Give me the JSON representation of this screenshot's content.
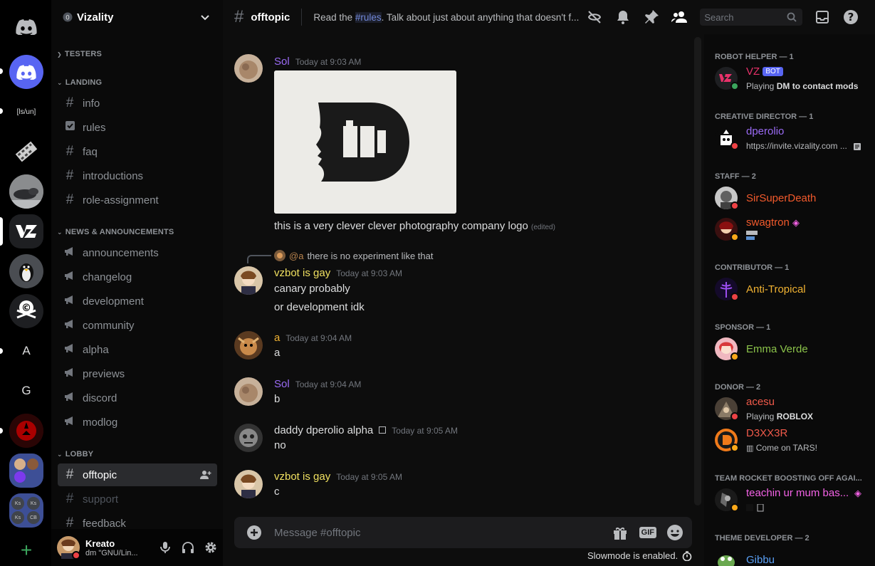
{
  "guild": {
    "name": "Vizality"
  },
  "rail": {
    "text_server_1": "[ls/un]",
    "letter_a": "A",
    "letter_g": "G",
    "folder_labels": [
      "Ks",
      "Ks",
      "Ks",
      "CB"
    ]
  },
  "categories": {
    "testers": "TESTERS",
    "landing": "LANDING",
    "news": "NEWS & ANNOUNCEMENTS",
    "lobby": "LOBBY"
  },
  "channels": {
    "landing": [
      "info",
      "rules",
      "faq",
      "introductions",
      "role-assignment"
    ],
    "news": [
      "announcements",
      "changelog",
      "development",
      "community",
      "alpha",
      "previews",
      "discord",
      "modlog"
    ],
    "lobby": [
      "offtopic",
      "support",
      "feedback"
    ]
  },
  "user": {
    "name": "Kreato",
    "status": "dm \"GNU/Lin..."
  },
  "header": {
    "channel": "offtopic",
    "topic_prefix": "Read the ",
    "topic_mention": "#rules",
    "topic_suffix": ". Talk about just about anything that doesn't f...",
    "search_placeholder": "Search"
  },
  "messages": [
    {
      "author": "Sol",
      "time": "Today at 9:03 AM",
      "text": "this is a very clever clever photography company logo",
      "edited": "(edited)"
    },
    {
      "reply_author": "@a",
      "reply_text": "there is no experiment like that",
      "author": "vzbot is gay",
      "time": "Today at 9:03 AM",
      "lines": [
        "canary probably",
        "or development idk"
      ]
    },
    {
      "author": "a",
      "time": "Today at 9:04 AM",
      "text": "a"
    },
    {
      "author": "Sol",
      "time": "Today at 9:04 AM",
      "text": "b"
    },
    {
      "author": "daddy dperolio alpha",
      "time": "Today at 9:05 AM",
      "text": "no"
    },
    {
      "author": "vzbot is gay",
      "time": "Today at 9:05 AM",
      "text": "c"
    }
  ],
  "composer": {
    "placeholder": "Message #offtopic",
    "gif": "GIF",
    "slowmode": "Slowmode is enabled."
  },
  "members": {
    "groups": [
      {
        "title": "ROBOT HELPER — 1"
      },
      {
        "title": "CREATIVE DIRECTOR — 1"
      },
      {
        "title": "STAFF — 2"
      },
      {
        "title": "CONTRIBUTOR — 1"
      },
      {
        "title": "SPONSOR — 1"
      },
      {
        "title": "DONOR — 2"
      },
      {
        "title": "TEAM ROCKET BOOSTING OFF AGAI..."
      },
      {
        "title": "THEME DEVELOPER — 2"
      }
    ],
    "list": [
      {
        "name": "VZ",
        "badge": "BOT",
        "act_pre": "Playing ",
        "act_bold": "DM to contact mods",
        "color": "#e8316a"
      },
      {
        "name": "dperolio",
        "act_pre": "https://invite.vizality.com ...",
        "act_bold": "",
        "color": "#9b6bf5"
      },
      {
        "name": "SirSuperDeath",
        "color": "#f25a2c"
      },
      {
        "name": "swagtron",
        "color": "#f25a2c"
      },
      {
        "name": "Anti-Tropical",
        "color": "#f0b232"
      },
      {
        "name": "Emma Verde",
        "color": "#8bc34a"
      },
      {
        "name": "acesu",
        "act_pre": "Playing ",
        "act_bold": "ROBLOX",
        "color": "#f05a4a"
      },
      {
        "name": "D3XX3R",
        "act_pre": "Come on TARS!",
        "act_bold": "",
        "color": "#f05a4a"
      },
      {
        "name": "teachin ur mum bas...",
        "color": "#f462e6"
      },
      {
        "name": "Gibbu",
        "color": "#5aa0f5"
      }
    ]
  }
}
